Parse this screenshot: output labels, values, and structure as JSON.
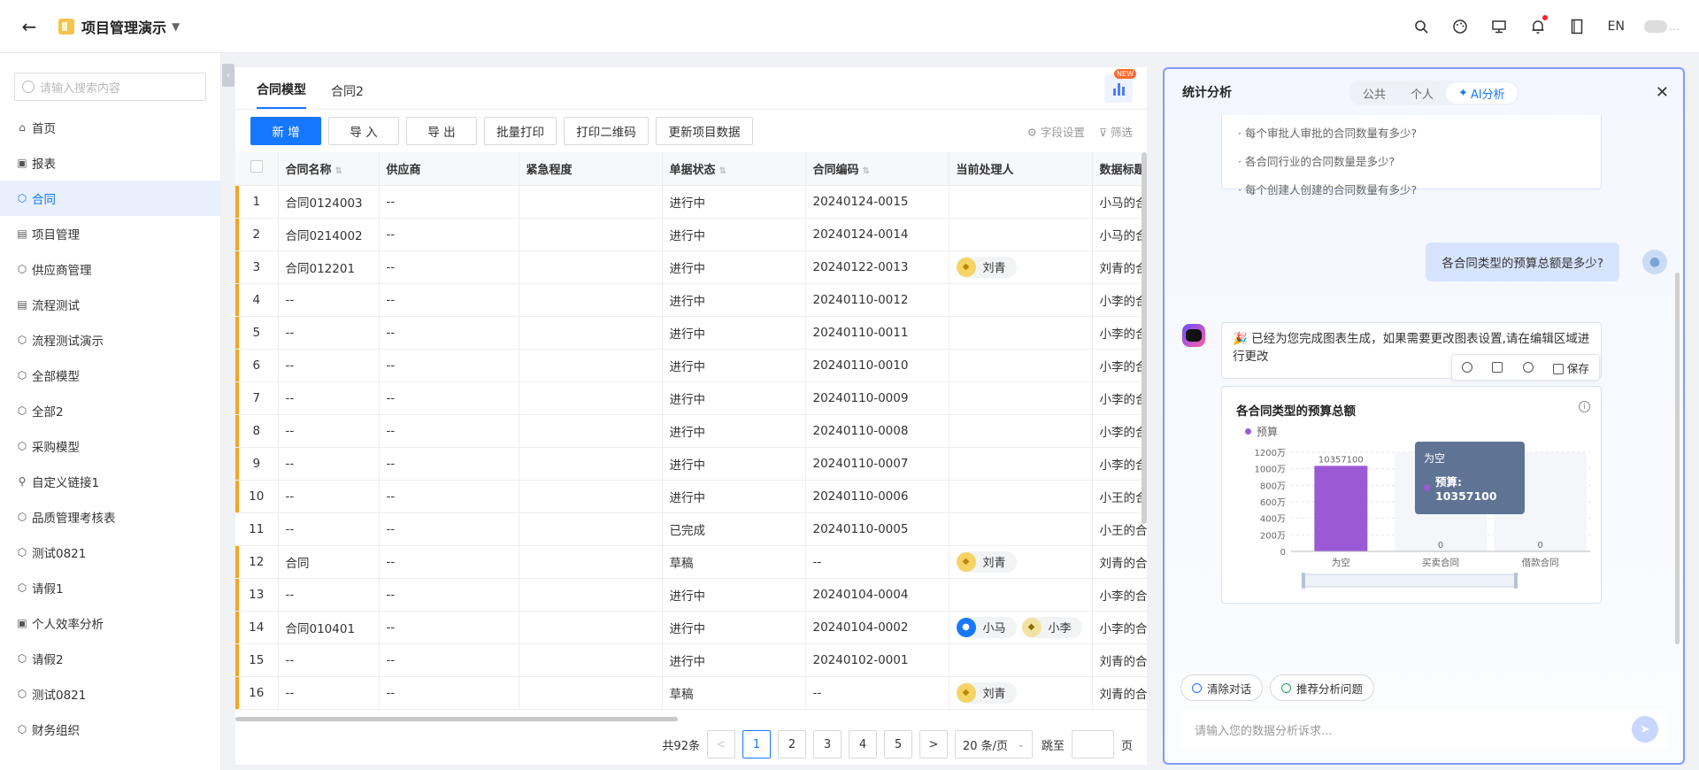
{
  "topbar": {
    "back": "←",
    "project_title": "项目管理演示",
    "caret": "▼",
    "lang": "EN",
    "user_name": "…"
  },
  "sidebar": {
    "search_placeholder": "请输入搜索内容",
    "items": [
      {
        "label": "首页",
        "icon": "home-icon",
        "glyph": "⌂"
      },
      {
        "label": "报表",
        "icon": "report-icon",
        "glyph": "▣"
      },
      {
        "label": "合同",
        "icon": "cube-icon",
        "glyph": "⬡",
        "active": true
      },
      {
        "label": "项目管理",
        "icon": "doc-icon",
        "glyph": "▤"
      },
      {
        "label": "供应商管理",
        "icon": "cube-icon",
        "glyph": "⬡"
      },
      {
        "label": "流程测试",
        "icon": "doc-icon",
        "glyph": "▤"
      },
      {
        "label": "流程测试演示",
        "icon": "cube-icon",
        "glyph": "⬡"
      },
      {
        "label": "全部模型",
        "icon": "cube-icon",
        "glyph": "⬡"
      },
      {
        "label": "全部2",
        "icon": "cube-icon",
        "glyph": "⬡"
      },
      {
        "label": "采购模型",
        "icon": "cube-icon",
        "glyph": "⬡"
      },
      {
        "label": "自定义链接1",
        "icon": "link-icon",
        "glyph": "⚲"
      },
      {
        "label": "品质管理考核表",
        "icon": "cube-icon",
        "glyph": "⬡"
      },
      {
        "label": "测试0821",
        "icon": "cube-icon",
        "glyph": "⬡"
      },
      {
        "label": "请假1",
        "icon": "cube-icon",
        "glyph": "⬡"
      },
      {
        "label": "个人效率分析",
        "icon": "report-icon",
        "glyph": "▣"
      },
      {
        "label": "请假2",
        "icon": "cube-icon",
        "glyph": "⬡"
      },
      {
        "label": "测试0821",
        "icon": "cube-icon",
        "glyph": "⬡"
      },
      {
        "label": "财务组织",
        "icon": "cube-icon",
        "glyph": "⬡"
      }
    ]
  },
  "main": {
    "tabs": [
      "合同模型",
      "合同2"
    ],
    "new_badge": "NEW",
    "toolbar": {
      "buttons": [
        "新 增",
        "导 入",
        "导 出",
        "批量打印",
        "打印二维码",
        "更新项目数据"
      ],
      "field_settings": "字段设置",
      "filter": "筛选"
    },
    "columns": [
      "合同名称",
      "供应商",
      "紧急程度",
      "单据状态",
      "合同编码",
      "当前处理人",
      "数据标题"
    ],
    "rows": [
      {
        "idx": "1",
        "name": "合同0124003",
        "supplier": "--",
        "urgency": "",
        "status": "进行中",
        "code": "20240124-0015",
        "handlers": [],
        "title": "小马的合",
        "flag": true
      },
      {
        "idx": "2",
        "name": "合同0214002",
        "supplier": "--",
        "urgency": "",
        "status": "进行中",
        "code": "20240124-0014",
        "handlers": [],
        "title": "小马的合",
        "flag": true
      },
      {
        "idx": "3",
        "name": "合同012201",
        "supplier": "--",
        "urgency": "",
        "status": "进行中",
        "code": "20240122-0013",
        "handlers": [
          {
            "name": "刘青",
            "style": "gold"
          }
        ],
        "title": "刘青的合",
        "flag": true
      },
      {
        "idx": "4",
        "name": "--",
        "supplier": "--",
        "urgency": "",
        "status": "进行中",
        "code": "20240110-0012",
        "handlers": [],
        "title": "小李的合",
        "flag": true
      },
      {
        "idx": "5",
        "name": "--",
        "supplier": "--",
        "urgency": "",
        "status": "进行中",
        "code": "20240110-0011",
        "handlers": [],
        "title": "小李的合",
        "flag": true
      },
      {
        "idx": "6",
        "name": "--",
        "supplier": "--",
        "urgency": "",
        "status": "进行中",
        "code": "20240110-0010",
        "handlers": [],
        "title": "小李的合",
        "flag": true
      },
      {
        "idx": "7",
        "name": "--",
        "supplier": "--",
        "urgency": "",
        "status": "进行中",
        "code": "20240110-0009",
        "handlers": [],
        "title": "小李的合",
        "flag": true
      },
      {
        "idx": "8",
        "name": "--",
        "supplier": "--",
        "urgency": "",
        "status": "进行中",
        "code": "20240110-0008",
        "handlers": [],
        "title": "小李的合",
        "flag": true
      },
      {
        "idx": "9",
        "name": "--",
        "supplier": "--",
        "urgency": "",
        "status": "进行中",
        "code": "20240110-0007",
        "handlers": [],
        "title": "小李的合",
        "flag": true
      },
      {
        "idx": "10",
        "name": "--",
        "supplier": "--",
        "urgency": "",
        "status": "进行中",
        "code": "20240110-0006",
        "handlers": [],
        "title": "小王的合",
        "flag": true
      },
      {
        "idx": "11",
        "name": "--",
        "supplier": "--",
        "urgency": "",
        "status": "已完成",
        "code": "20240110-0005",
        "handlers": [],
        "title": "小王的合",
        "flag": false
      },
      {
        "idx": "12",
        "name": "合同",
        "supplier": "--",
        "urgency": "",
        "status": "草稿",
        "code": "--",
        "handlers": [
          {
            "name": "刘青",
            "style": "gold"
          }
        ],
        "title": "刘青的合",
        "flag": true
      },
      {
        "idx": "13",
        "name": "--",
        "supplier": "--",
        "urgency": "",
        "status": "进行中",
        "code": "20240104-0004",
        "handlers": [],
        "title": "小李的合",
        "flag": true
      },
      {
        "idx": "14",
        "name": "合同010401",
        "supplier": "--",
        "urgency": "",
        "status": "进行中",
        "code": "20240104-0002",
        "handlers": [
          {
            "name": "小马",
            "style": "blue"
          },
          {
            "name": "小李",
            "style": "ylw"
          }
        ],
        "title": "小李的合",
        "flag": true
      },
      {
        "idx": "15",
        "name": "--",
        "supplier": "--",
        "urgency": "",
        "status": "进行中",
        "code": "20240102-0001",
        "handlers": [],
        "title": "刘青的合",
        "flag": true
      },
      {
        "idx": "16",
        "name": "--",
        "supplier": "--",
        "urgency": "",
        "status": "草稿",
        "code": "--",
        "handlers": [
          {
            "name": "刘青",
            "style": "gold"
          }
        ],
        "title": "刘青的合",
        "flag": true
      }
    ],
    "pager": {
      "total": "共92条",
      "pages": [
        "1",
        "2",
        "3",
        "4",
        "5"
      ],
      "current": "1",
      "prev": "<",
      "next": ">",
      "size": "20 条/页",
      "jump_label": "跳至",
      "page_label": "页"
    }
  },
  "ai": {
    "title": "统计分析",
    "tabs": [
      "公共",
      "个人",
      "AI分析"
    ],
    "active_tab": "AI分析",
    "close": "✕",
    "suggestions": [
      "· 每个审批人审批的合同数量有多少?",
      "· 各合同行业的合同数量是多少?",
      "· 每个创建人创建的合同数量有多少?"
    ],
    "user_question": "各合同类型的预算总额是多少?",
    "bot_reply": "🎉 已经为您完成图表生成，如果需要更改图表设置,请在编辑区域进行更改",
    "actions_save": "保存",
    "chips": [
      "清除对话",
      "推荐分析问题"
    ],
    "input_placeholder": "请输入您的数据分析诉求...",
    "colors": {
      "bar": "#9b59d6",
      "accent": "#1677ff",
      "border": "#7f9bff"
    }
  },
  "chart_data": {
    "type": "bar",
    "title": "各合同类型的预算总额",
    "categories": [
      "为空",
      "买卖合同",
      "借款合同"
    ],
    "series": [
      {
        "name": "预算",
        "values": [
          10357100,
          0,
          0
        ]
      }
    ],
    "data_labels": [
      "10357100",
      "0",
      "0"
    ],
    "yticks": [
      "0",
      "200万",
      "400万",
      "600万",
      "800万",
      "1000万",
      "1200万"
    ],
    "ylim": [
      0,
      12000000
    ],
    "legend": "top-left",
    "tooltip": {
      "title": "为空",
      "text": "预算: 10357100"
    }
  }
}
